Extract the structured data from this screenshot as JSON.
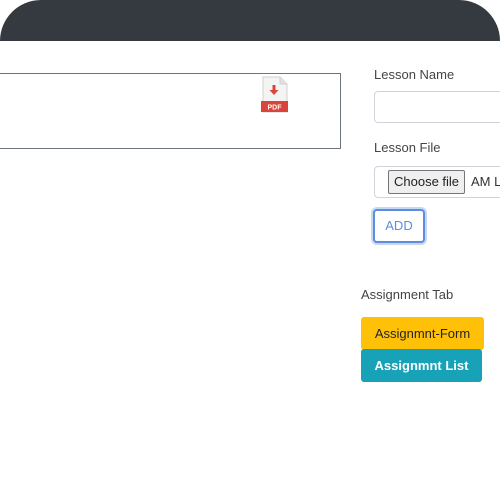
{
  "lesson_card": {
    "attachment_icon": "pdf-file-icon",
    "attachment_icon_text": "PDF"
  },
  "form": {
    "lesson_name_label": "Lesson Name",
    "lesson_name_value": "",
    "lesson_file_label": "Lesson File",
    "choose_file_label": "Choose file",
    "file_name": "AM L",
    "add_label": "ADD"
  },
  "assignment": {
    "section_label": "Assignment Tab",
    "form_button_label": "Assignmnt-Form",
    "list_button_label": "Assignmnt List"
  },
  "colors": {
    "frame": "#343a40",
    "warning": "#ffc107",
    "info": "#17a2b8",
    "primary_outline": "#5b8de0",
    "pdf_red": "#d9453a"
  }
}
